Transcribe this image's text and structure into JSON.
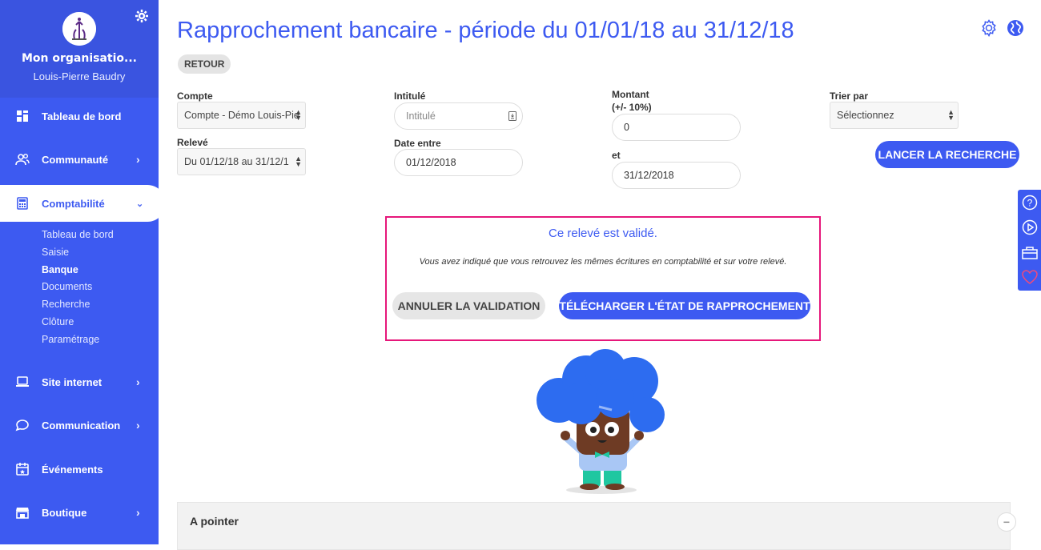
{
  "sidebar": {
    "org_name": "Mon organisatio...",
    "user_name": "Louis-Pierre Baudry",
    "items": [
      {
        "label": "Tableau de bord",
        "icon": "dashboard-icon"
      },
      {
        "label": "Communauté",
        "icon": "community-icon"
      },
      {
        "label": "Comptabilité",
        "icon": "calculator-icon"
      },
      {
        "label": "Site internet",
        "icon": "laptop-icon"
      },
      {
        "label": "Communication",
        "icon": "chat-icon"
      },
      {
        "label": "Événements",
        "icon": "calendar-icon"
      },
      {
        "label": "Boutique",
        "icon": "shop-icon"
      }
    ],
    "sub_items": [
      "Tableau de bord",
      "Saisie",
      "Banque",
      "Documents",
      "Recherche",
      "Clôture",
      "Paramétrage"
    ],
    "current_sub": "Banque"
  },
  "header": {
    "title": "Rapprochement bancaire - période du 01/01/18 au 31/12/18",
    "retour": "RETOUR"
  },
  "filters": {
    "compte_label": "Compte",
    "compte_value": "Compte - Démo Louis-Pie",
    "releve_label": "Relevé",
    "releve_value": "Du 01/12/18 au 31/12/1",
    "intitule_label": "Intitulé",
    "intitule_placeholder": "Intitulé",
    "date_label": "Date entre",
    "date_value": "01/12/2018",
    "montant_label": "Montant",
    "montant_sub": "(+/- 10%)",
    "montant_value": "0",
    "et_label": "et",
    "et_value": "31/12/2018",
    "trier_label": "Trier par",
    "trier_value": "Sélectionnez",
    "search_button": "LANCER LA RECHERCHE"
  },
  "validation": {
    "title": "Ce relevé est validé.",
    "description": "Vous avez indiqué que vous retrouvez les mêmes écritures en comptabilité et sur votre relevé.",
    "cancel_button": "ANNULER LA VALIDATION",
    "download_button": "TÉLÉCHARGER L'ÉTAT DE RAPPROCHEMENT"
  },
  "section": {
    "title": "A pointer",
    "collapse": "−"
  },
  "colors": {
    "primary": "#3d5af1",
    "highlight_border": "#e6177a",
    "mascot_hair": "#2d6cf0",
    "mascot_body": "#6e3b24"
  }
}
